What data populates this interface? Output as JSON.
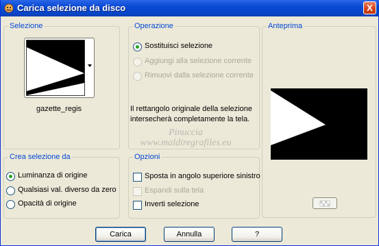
{
  "window": {
    "title": "Carica selezione da disco",
    "close_label": "X"
  },
  "selezione": {
    "label": "Selezione",
    "preset_name": "gazette_regis"
  },
  "operazione": {
    "label": "Operazione",
    "options": [
      {
        "label": "Sostituisci selezione",
        "selected": true,
        "enabled": true
      },
      {
        "label": "Aggiungi alla selezione corrente",
        "selected": false,
        "enabled": false
      },
      {
        "label": "Rimuovi dalla selezione corrente",
        "selected": false,
        "enabled": false
      }
    ],
    "info_line1": "Il rettangolo originale della selezione",
    "info_line2": "intersecherà completamente la tela."
  },
  "anteprima": {
    "label": "Anteprima"
  },
  "crea": {
    "label": "Crea selezione da",
    "options": [
      {
        "label": "Luminanza di origine",
        "selected": true
      },
      {
        "label": "Qualsiasi val. diverso da zero",
        "selected": false
      },
      {
        "label": "Opacità di origine",
        "selected": false
      }
    ]
  },
  "opzioni": {
    "label": "Opzioni",
    "options": [
      {
        "label": "Sposta in angolo superiore sinistro",
        "checked": false,
        "enabled": true
      },
      {
        "label": "Espandi sulla tela",
        "checked": false,
        "enabled": false
      },
      {
        "label": "Inverti selezione",
        "checked": false,
        "enabled": true
      }
    ]
  },
  "buttons": {
    "load": "Carica",
    "cancel": "Annulla",
    "help": "?"
  },
  "watermark": {
    "line1": "Pinuccia",
    "line2": "www.maldiregrafiles.eu"
  },
  "colors": {
    "titlebar": "#0a4ad4",
    "group_label": "#0046d5",
    "dialog_bg": "#ece9d8"
  }
}
